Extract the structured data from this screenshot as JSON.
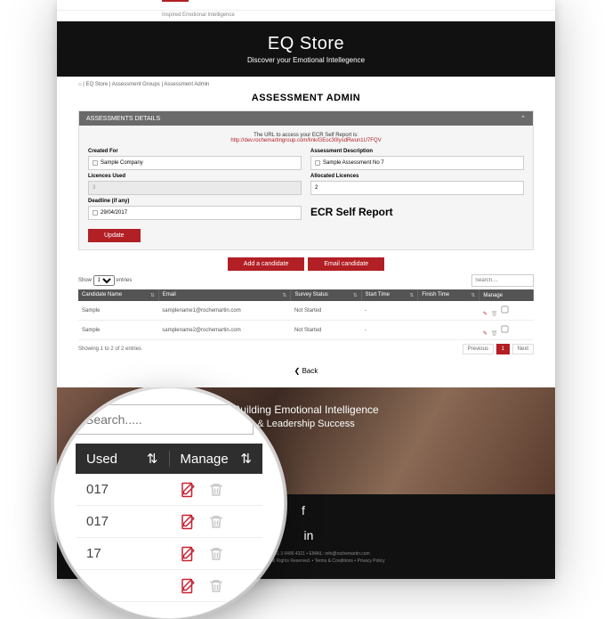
{
  "top": {
    "tagline": "Inspired Emotional Intelligence"
  },
  "hero": {
    "title": "EQ Store",
    "subtitle": "Discover your Emotional Intellegence"
  },
  "crumbs": {
    "home": "⌂",
    "a": "EQ Store",
    "b": "Assessment Groups",
    "c": "Assessment Admin"
  },
  "page_title": "ASSESSMENT ADMIN",
  "panel": {
    "heading": "ASSESSMENTS DETAILS",
    "url_msg": "The URL to access your ECR Self Report is:",
    "url": "http://dev.rochemartingroup.com/link/GEoc30lysdRwun1U7FQV",
    "created_for_lbl": "Created For",
    "created_for_val": "Sample Company",
    "desc_lbl": "Assessment Description",
    "desc_val": "Sample Assessment No 7",
    "licences_used_lbl": "Licences Used",
    "licences_used_val": "3",
    "alloc_lbl": "Allocated Licences",
    "alloc_val": "2",
    "deadline_lbl": "Deadline (if any)",
    "deadline_val": "29/04/2017",
    "report_name": "ECR Self Report",
    "update_btn": "Update"
  },
  "actions": {
    "add": "Add a candidate",
    "email": "Email candidate"
  },
  "table": {
    "show": "Show",
    "entries": "entries",
    "page_size": "10",
    "search_ph": "Search....",
    "cols": {
      "name": "Candidate Name",
      "email": "Email",
      "status": "Survey Status",
      "start": "Start Time",
      "finish": "Finish Time",
      "manage": "Manage"
    },
    "rows": [
      {
        "name": "Sample",
        "email": "samplename1@rochemartin.com",
        "status": "Not Started",
        "start": "-",
        "finish": ""
      },
      {
        "name": "Sample",
        "email": "samplename2@rochemartin.com",
        "status": "Not Started",
        "start": "-",
        "finish": ""
      }
    ],
    "info": "Showing 1 to 2 of 2 entries",
    "prev": "Previous",
    "pg": "1",
    "next": "Next"
  },
  "back": "❮ Back",
  "footer": {
    "line1": "Building Emotional Intelligence",
    "line2": "& Leadership Success",
    "contact": "TELEPHONE: +61 3 9486 4321 • EMAIL: info@rochemartin.com",
    "legal": "© RocheMartin 2017. All Rights Reserved. • Terms & Conditions • Privacy Policy"
  },
  "magnifier": {
    "search_ph": "Search.....",
    "col1": "Used",
    "col2": "Manage",
    "rows": [
      {
        "v": "017"
      },
      {
        "v": "017"
      },
      {
        "v": "17"
      },
      {
        "v": ""
      }
    ]
  },
  "colors": {
    "brand": "#b21f24"
  }
}
